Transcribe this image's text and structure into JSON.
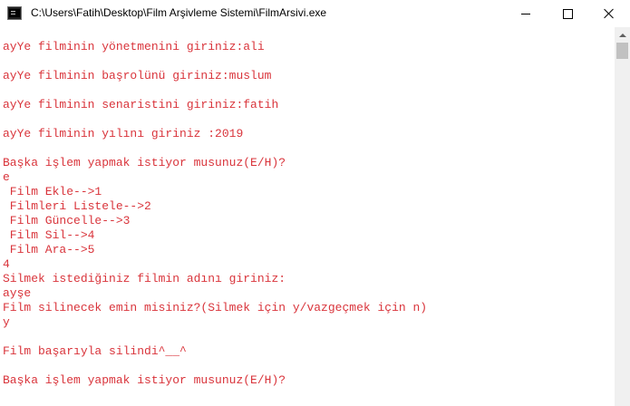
{
  "window": {
    "title": "C:\\Users\\Fatih\\Desktop\\Film Arşivleme Sistemi\\FilmArsivi.exe",
    "colors": {
      "console_text": "#d9343b",
      "console_background": "#ffffff",
      "titlebar_background": "#ffffff"
    },
    "icons": {
      "app": "console-app-icon",
      "minimize": "minimize-icon",
      "maximize": "maximize-icon",
      "close": "close-icon"
    }
  },
  "console": {
    "lines": [
      "ayYe filminin yönetmenini giriniz:ali",
      "",
      "ayYe filminin başrolünü giriniz:muslum",
      "",
      "ayYe filminin senaristini giriniz:fatih",
      "",
      "ayYe filminin yılını giriniz :2019",
      "",
      "Başka işlem yapmak istiyor musunuz(E/H)?",
      "e",
      " Film Ekle-->1",
      " Filmleri Listele-->2",
      " Film Güncelle-->3",
      " Film Sil-->4",
      " Film Ara-->5",
      "4",
      "Silmek istediğiniz filmin adını giriniz:",
      "ayşe",
      "Film silinecek emin misiniz?(Silmek için y/vazgeçmek için n)",
      "y",
      "",
      "Film başarıyla silindi^__^",
      "",
      "Başka işlem yapmak istiyor musunuz(E/H)?"
    ]
  }
}
